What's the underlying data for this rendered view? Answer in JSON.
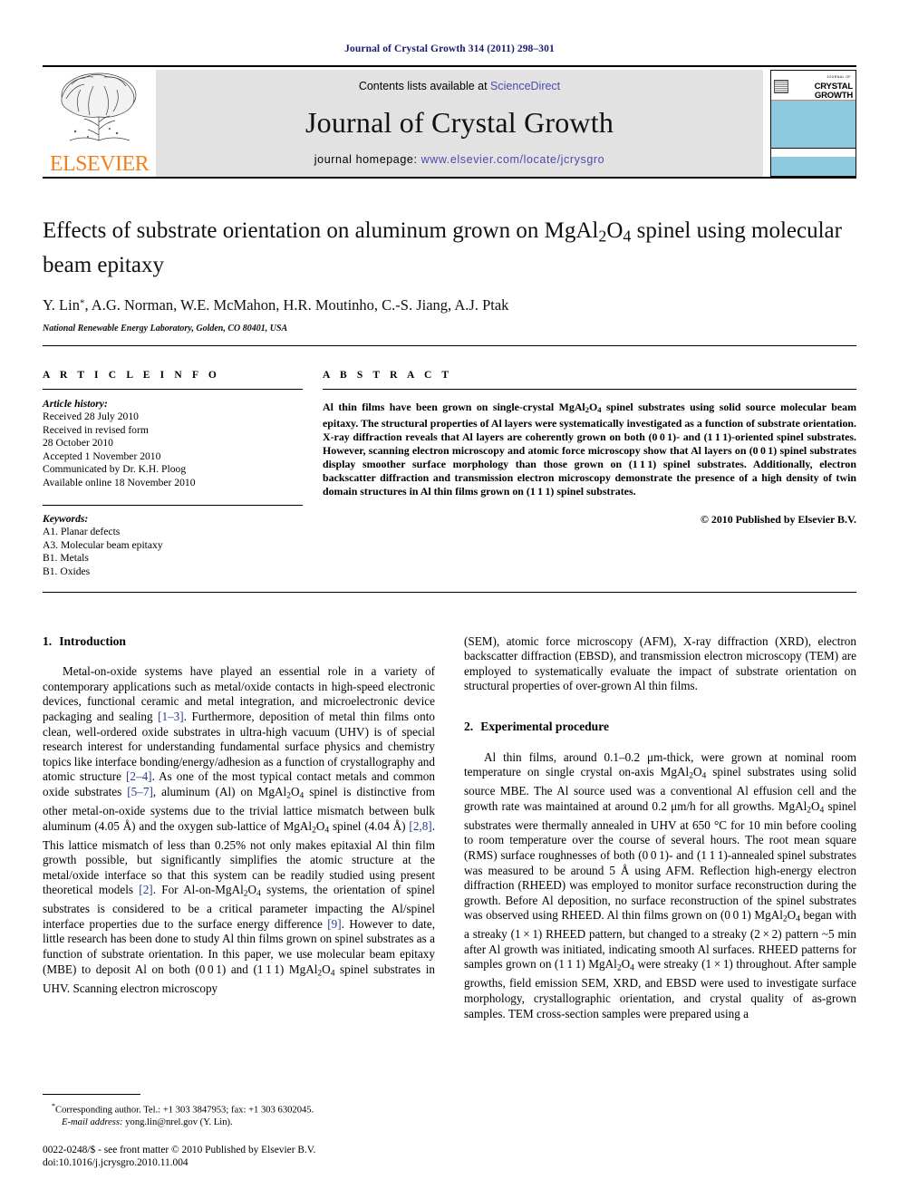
{
  "running_head": "Journal of Crystal Growth 314 (2011) 298–301",
  "banner": {
    "publisher_wordmark": "ELSEVIER",
    "contents_prefix": "Contents lists available at ",
    "contents_link": "ScienceDirect",
    "journal_title": "Journal of Crystal Growth",
    "homepage_prefix": "journal homepage: ",
    "homepage_url": "www.elsevier.com/locate/jcrysgro",
    "cover": {
      "kicker": "JOURNAL OF",
      "line1": "CRYSTAL",
      "line2": "GROWTH",
      "band_color": "#8ECADF"
    }
  },
  "article": {
    "title": "Effects of substrate orientation on aluminum grown on MgAl2O4 spinel using molecular beam epitaxy",
    "authors": "Y. Lin *, A.G. Norman, W.E. McMahon, H.R. Moutinho, C.-S. Jiang, A.J. Ptak",
    "affiliation": "National Renewable Energy Laboratory, Golden, CO 80401, USA"
  },
  "article_info": {
    "heading": "A R T I C L E   I N F O",
    "history_label": "Article history:",
    "history": [
      "Received 28 July 2010",
      "Received in revised form",
      "28 October 2010",
      "Accepted 1 November 2010",
      "Communicated by Dr. K.H. Ploog",
      "Available online 18 November 2010"
    ],
    "keywords_label": "Keywords:",
    "keywords": [
      "A1. Planar defects",
      "A3. Molecular beam epitaxy",
      "B1. Metals",
      "B1. Oxides"
    ]
  },
  "abstract": {
    "heading": "A B S T R A C T",
    "text": "Al thin films have been grown on single-crystal MgAl2O4 spinel substrates using solid source molecular beam epitaxy. The structural properties of Al layers were systematically investigated as a function of substrate orientation. X-ray diffraction reveals that Al layers are coherently grown on both (0 0 1)- and (1 1 1)-oriented spinel substrates. However, scanning electron microscopy and atomic force microscopy show that Al layers on (0 0 1) spinel substrates display smoother surface morphology than those grown on (1 1 1) spinel substrates. Additionally, electron backscatter diffraction and transmission electron microscopy demonstrate the presence of a high density of twin domain structures in Al thin films grown on (1 1 1) spinel substrates.",
    "copyright": "© 2010 Published by Elsevier B.V."
  },
  "sections": {
    "intro": {
      "number": "1.",
      "title": "Introduction",
      "paragraph_1": "Metal-on-oxide systems have played an essential role in a variety of contemporary applications such as metal/oxide contacts in high-speed electronic devices, functional ceramic and metal integration, and microelectronic device packaging and sealing [1–3]. Furthermore, deposition of metal thin films onto clean, well-ordered oxide substrates in ultra-high vacuum (UHV) is of special research interest for understanding fundamental surface physics and chemistry topics like interface bonding/energy/adhesion as a function of crystallography and atomic structure [2–4]. As one of the most typical contact metals and common oxide substrates [5–7], aluminum (Al) on MgAl2O4 spinel is distinctive from other metal-on-oxide systems due to the trivial lattice mismatch between bulk aluminum (4.05 Å) and the oxygen sub-lattice of MgAl2O4 spinel (4.04 Å) [2,8]. This lattice mismatch of less than 0.25% not only makes epitaxial Al thin film growth possible, but significantly simplifies the atomic structure at the metal/oxide interface so that this system can be readily studied using present theoretical models [2]. For Al-on-MgAl2O4 systems, the orientation of spinel substrates is considered to be a critical parameter impacting the Al/spinel interface properties due to the surface energy difference [9]. However to date, little research has been done to study Al thin films grown on spinel substrates as a function of substrate orientation. In this paper, we use molecular beam epitaxy (MBE) to deposit Al on both (0 0 1) and (1 1 1) MgAl2O4 spinel substrates in UHV. Scanning electron microscopy",
      "paragraph_2": "(SEM), atomic force microscopy (AFM), X-ray diffraction (XRD), electron backscatter diffraction (EBSD), and transmission electron microscopy (TEM) are employed to systematically evaluate the impact of substrate orientation on structural properties of over-grown Al thin films."
    },
    "experimental": {
      "number": "2.",
      "title": "Experimental procedure",
      "paragraph_1": "Al thin films, around 0.1–0.2 μm-thick, were grown at nominal room temperature on single crystal on-axis MgAl2O4 spinel substrates using solid source MBE. The Al source used was a conventional Al effusion cell and the growth rate was maintained at around 0.2 μm/h for all growths. MgAl2O4 spinel substrates were thermally annealed in UHV at 650 °C for 10 min before cooling to room temperature over the course of several hours. The root mean square (RMS) surface roughnesses of both (0 0 1)- and (1 1 1)-annealed spinel substrates was measured to be around 5 Å using AFM. Reflection high-energy electron diffraction (RHEED) was employed to monitor surface reconstruction during the growth. Before Al deposition, no surface reconstruction of the spinel substrates was observed using RHEED. Al thin films grown on (0 0 1) MgAl2O4 began with a streaky (1 × 1) RHEED pattern, but changed to a streaky (2 × 2) pattern ~5 min after Al growth was initiated, indicating smooth Al surfaces. RHEED patterns for samples grown on (1 1 1) MgAl2O4 were streaky (1 × 1) throughout. After sample growths, field emission SEM, XRD, and EBSD were used to investigate surface morphology, crystallographic orientation, and crystal quality of as-grown samples. TEM cross-section samples were prepared using a"
    }
  },
  "footnote": {
    "corresponding": "Corresponding author. Tel.: +1 303 3847953; fax: +1 303 6302045.",
    "email_label": "E-mail address:",
    "email": "yong.lin@nrel.gov (Y. Lin).",
    "issn_line": "0022-0248/$ - see front matter © 2010 Published by Elsevier B.V.",
    "doi_line": "doi:10.1016/j.jcrysgro.2010.11.004"
  }
}
